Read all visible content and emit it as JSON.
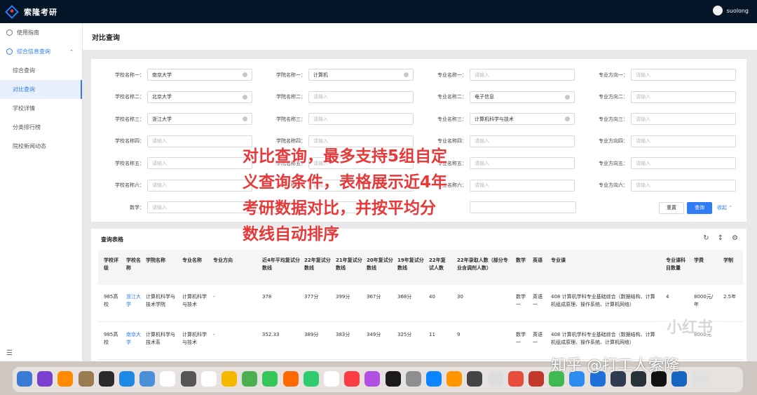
{
  "app": {
    "title": "索隆考研",
    "user": "suolong"
  },
  "sidebar": {
    "items": [
      {
        "label": "使用指南"
      },
      {
        "label": "综合信息查询"
      }
    ],
    "sub": [
      {
        "label": "综合查询"
      },
      {
        "label": "对比查询"
      },
      {
        "label": "学校详情"
      },
      {
        "label": "分类排行榜"
      },
      {
        "label": "院校新闻动态"
      }
    ]
  },
  "page": {
    "title": "对比查询"
  },
  "filter": {
    "placeholder": "请输入",
    "rows": [
      {
        "school_label": "学校名称一：",
        "school": "南京大学",
        "college_label": "学院名称一：",
        "college": "计算机",
        "major_label": "专业名称一：",
        "major": "",
        "dir_label": "专业方向一：",
        "dir": ""
      },
      {
        "school_label": "学校名称二：",
        "school": "北京大学",
        "college_label": "学院名称二：",
        "college": "",
        "major_label": "专业名称二：",
        "major": "电子信息",
        "dir_label": "专业方向二：",
        "dir": ""
      },
      {
        "school_label": "学校名称三：",
        "school": "浙江大学",
        "college_label": "学院名称三：",
        "college": "",
        "major_label": "专业名称三：",
        "major": "计算机科学与技术",
        "dir_label": "专业方向三：",
        "dir": ""
      },
      {
        "school_label": "学校名称四：",
        "school": "",
        "college_label": "学院名称四：",
        "college": "",
        "major_label": "专业名称四：",
        "major": "",
        "dir_label": "专业方向四：",
        "dir": ""
      },
      {
        "school_label": "学校名称五：",
        "school": "",
        "college_label": "学院名称五：",
        "college": "",
        "major_label": "专业名称五：",
        "major": "",
        "dir_label": "专业方向五：",
        "dir": ""
      },
      {
        "school_label": "学校名称六：",
        "school": "",
        "college_label": "学院名称六：",
        "college": "",
        "major_label": "专业名称六：",
        "major": "",
        "dir_label": "专业方向六：",
        "dir": ""
      }
    ],
    "math_label": "数学：",
    "reset": "重置",
    "query": "查询",
    "collapse": "收起 ⌃"
  },
  "table": {
    "title": "查询表格",
    "headers": {
      "level": "学校评级",
      "school": "学校名称",
      "college": "学院名称",
      "major": "专业名称",
      "dir": "专业方向",
      "avg": "近4年平均复试分数线",
      "s22": "22年复试分数线",
      "s21": "21年复试分数线",
      "s20": "20年复试分数线",
      "s19": "19年复试分数线",
      "n22": "22年复试人数",
      "admit": "22年录取人数（部分专业含调剂人数）",
      "math": "数学",
      "eng": "英语",
      "courses": "专业课",
      "ncourse": "专业课科目数量",
      "fee": "学费",
      "years": "学制"
    },
    "rows": [
      {
        "level": "985高校",
        "school": "浙江大学",
        "college": "计算机科学与技术学院",
        "major": "计算机科学与技术",
        "dir": "-",
        "avg": "378",
        "s22": "377分",
        "s21": "399分",
        "s20": "367分",
        "s19": "368分",
        "n22": "40",
        "admit": "30",
        "math": "数学一",
        "eng": "英语一",
        "courses": "408 计算机学科专业基础综合（数据结构、计算机组成原理、操作系统、计算机网络）",
        "ncourse": "4",
        "fee": "8000元/年",
        "years": "2.5年"
      },
      {
        "level": "985高校",
        "school": "南京大学",
        "college": "计算机科学与技术系",
        "major": "计算机科学与技术",
        "dir": "-",
        "avg": "352.33",
        "s22": "389分",
        "s21": "383分",
        "s20": "349分",
        "s19": "325分",
        "n22": "11",
        "admit": "9",
        "math": "数学一",
        "eng": "英语一",
        "courses": "408 计算机学科专业基础综合（数据结构、计算机组成原理、操作系统、计算机网络）",
        "ncourse": "",
        "fee": "8000元",
        "years": ""
      }
    ]
  },
  "overlay": {
    "line1": "对比查询，最多支持5组自定",
    "line2": "义查询条件，表格展示近4年",
    "line3": "考研数据对比，并按平均分",
    "line4": "数线自动排序"
  },
  "watermark": "知乎 @打工人索隆",
  "stamp": "小红书",
  "dock": {
    "colors": [
      "#3a7bd5",
      "#7a3fd0",
      "#ff8a00",
      "#9a7b4f",
      "#2b2b2b",
      "#1e88e5",
      "#4a90d9",
      "#ffffff",
      "#555555",
      "#ffffff",
      "#f5b800",
      "#4caf50",
      "#34c759",
      "#ff6a00",
      "#2ecc71",
      "#ffffff",
      "#fc3c44",
      "#b150e2",
      "#1c1c1e",
      "#8e8e93",
      "#0a84ff",
      "#ff9500",
      "#444444",
      "#dddddd",
      "#e74c3c",
      "#c0392b",
      "#3fb950",
      "#2d8cf0",
      "#1e6fd9",
      "#2f3b52",
      "#263238",
      "#111111",
      "#1565c0",
      "#e0e0e0"
    ]
  }
}
